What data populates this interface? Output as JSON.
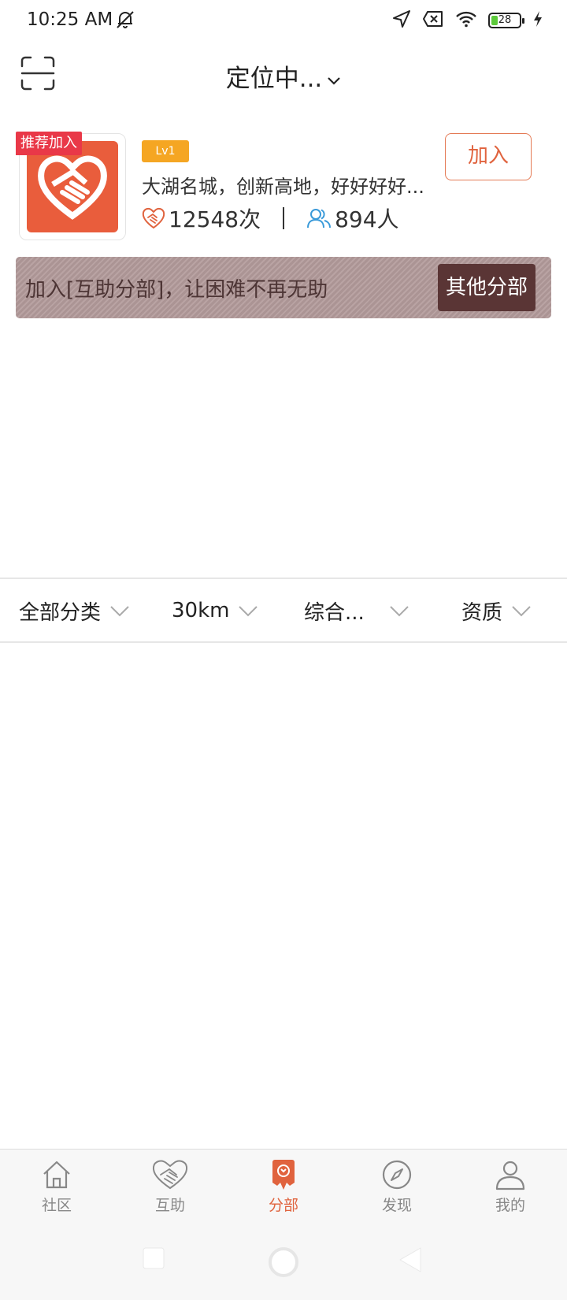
{
  "status_bar": {
    "time": "10:25 AM",
    "battery": "28"
  },
  "header": {
    "location_label": "定位中..."
  },
  "recommended": {
    "tag": "推荐加入",
    "level": "Lv1",
    "description": "大湖名城，创新高地，好好好好...",
    "help_count": "12548次",
    "member_count": "894人",
    "join_label": "加入"
  },
  "banner": {
    "text": "加入[互助分部]，让困难不再无助",
    "button_label": "其他分部"
  },
  "filters": [
    {
      "label": "全部分类"
    },
    {
      "label": "30km"
    },
    {
      "label": "综合..."
    },
    {
      "label": "资质"
    }
  ],
  "tab_bar": {
    "active": 2,
    "items": [
      {
        "label": "社区",
        "icon": "home-icon"
      },
      {
        "label": "互助",
        "icon": "heart-handshake-icon"
      },
      {
        "label": "分部",
        "icon": "branch-icon"
      },
      {
        "label": "发现",
        "icon": "compass-icon"
      },
      {
        "label": "我的",
        "icon": "user-icon"
      }
    ]
  },
  "colors": {
    "accent": "#e0633e",
    "logo_bg": "#e95d3c",
    "tag_red": "#e93848",
    "level_gold": "#f5a623",
    "banner_bg": "#b29a9a",
    "banner_btn": "#5a3535",
    "member_blue": "#3a9ad9"
  }
}
